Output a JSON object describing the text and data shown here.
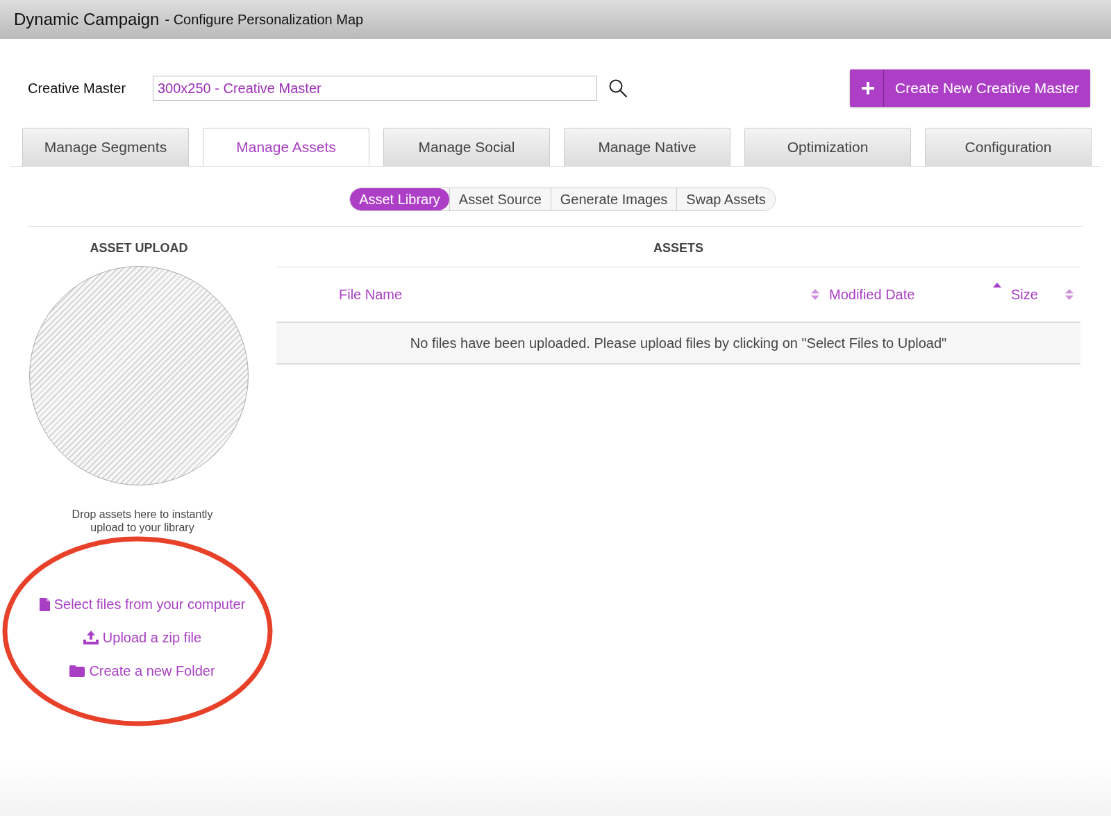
{
  "window": {
    "title": "Dynamic Campaign",
    "subtitle": "- Configure Personalization Map"
  },
  "creative_master": {
    "label": "Creative Master",
    "value": "300x250 - Creative Master"
  },
  "create_button": {
    "label": "Create New Creative Master"
  },
  "tabs": [
    {
      "label": "Manage Segments",
      "selected": false
    },
    {
      "label": "Manage Assets",
      "selected": true
    },
    {
      "label": "Manage Social",
      "selected": false
    },
    {
      "label": "Manage Native",
      "selected": false
    },
    {
      "label": "Optimization",
      "selected": false
    },
    {
      "label": "Configuration",
      "selected": false
    }
  ],
  "subtabs": [
    {
      "label": "Asset Library",
      "selected": true
    },
    {
      "label": "Asset Source",
      "selected": false
    },
    {
      "label": "Generate Images",
      "selected": false
    },
    {
      "label": "Swap Assets",
      "selected": false
    }
  ],
  "asset_upload": {
    "heading": "ASSET UPLOAD",
    "drop_hint": "Drop assets here to instantly upload to your library",
    "actions": [
      {
        "kind": "file",
        "label": "Select files from your computer"
      },
      {
        "kind": "upload",
        "label": "Upload a zip file"
      },
      {
        "kind": "folder",
        "label": "Create a new Folder"
      }
    ]
  },
  "assets": {
    "heading": "ASSETS",
    "columns": [
      {
        "label": "File Name",
        "sorted": false
      },
      {
        "label": "Modified Date",
        "sorted": true
      },
      {
        "label": "Size",
        "sorted": false
      }
    ],
    "empty_message": "No files have been uploaded. Please upload files by clicking on \"Select Files to Upload\""
  },
  "annotation": {
    "kind": "ellipse",
    "color": "#e8412a"
  }
}
